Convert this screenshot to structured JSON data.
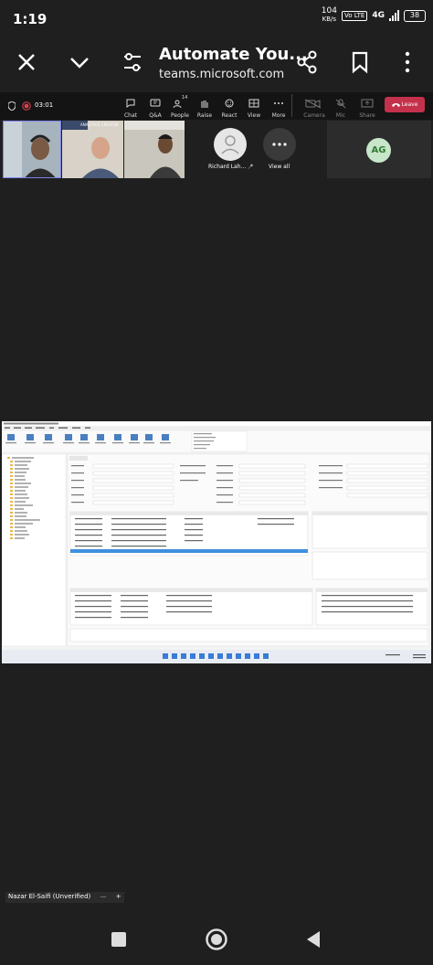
{
  "status": {
    "time": "1:19",
    "net_rate_value": "104",
    "net_rate_unit": "KB/s",
    "volte": "Vo LTE",
    "network": "4G",
    "battery": "38"
  },
  "browser": {
    "title": "Automate You...",
    "url": "teams.microsoft.com"
  },
  "meeting": {
    "timer": "03:01",
    "controls": [
      {
        "label": "Chat"
      },
      {
        "label": "Q&A"
      },
      {
        "label": "People",
        "count": "14"
      },
      {
        "label": "Raise"
      },
      {
        "label": "React"
      },
      {
        "label": "View"
      },
      {
        "label": "More"
      },
      {
        "label": "Camera"
      },
      {
        "label": "Mic"
      },
      {
        "label": "Share"
      }
    ],
    "leave_label": "Leave",
    "participant_richard": "Richard Lah...",
    "view_all": "View all",
    "initials": "AG",
    "presenter_name": "Nazar El-Saifi (Unverified)"
  }
}
